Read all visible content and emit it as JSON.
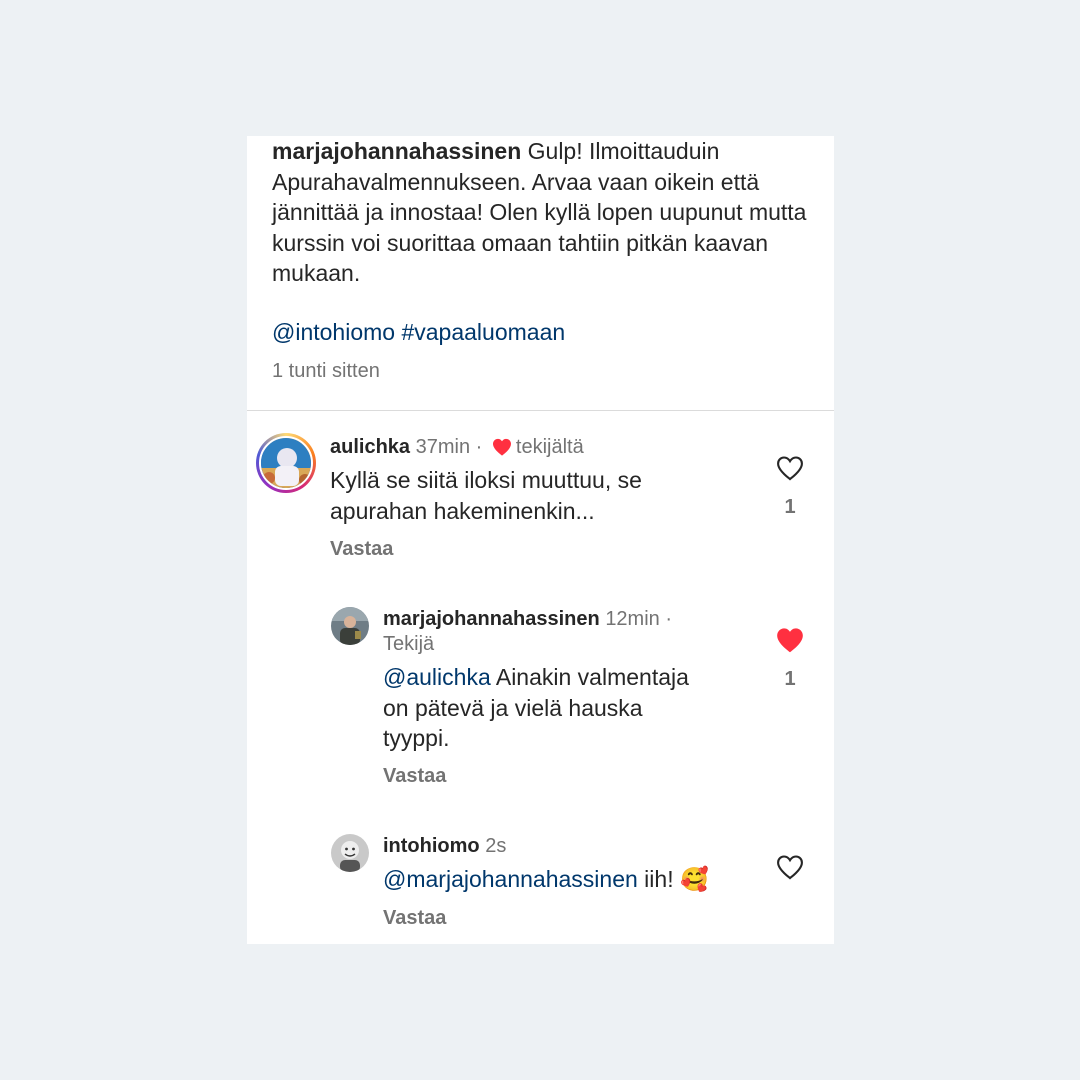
{
  "post": {
    "author": "marjajohannahassinen",
    "caption": "Gulp! Ilmoittauduin Apurahavalmennukseen. Arvaa vaan oikein että jännittää ja innostaa! Olen kyllä lopen uupunut mutta kurssin voi suorittaa omaan tahtiin pitkän kaavan mukaan.",
    "tag_mention": "@intohiomo",
    "tag_hashtag": "#vapaaluomaan",
    "time": "1 tunti sitten"
  },
  "comments": [
    {
      "username": "aulichka",
      "time": "37min",
      "separator": "·",
      "author_liked_label": "tekijältä",
      "text_line1": "Kyllä se siitä iloksi muuttuu, se",
      "text_line2": "apurahan hakeminenkin...",
      "reply_label": "Vastaa",
      "like_count": "1",
      "liked": false
    },
    {
      "username": "marjajohannahassinen",
      "time": "12min",
      "separator": "·",
      "badge": "Tekijä",
      "mention": "@aulichka",
      "text_line1_rest": " Ainakin valmentaja",
      "text_line2": "on pätevä ja vielä hauska",
      "text_line3": "tyyppi.",
      "reply_label": "Vastaa",
      "like_count": "1",
      "liked": true
    },
    {
      "username": "intohiomo",
      "time": "2s",
      "mention": "@marjajohannahassinen",
      "text_rest": " iih! ",
      "emoji": "🥰",
      "reply_label": "Vastaa",
      "liked": false
    }
  ],
  "colors": {
    "background": "#edf1f4",
    "card": "#ffffff",
    "text": "#262626",
    "secondary": "#737373",
    "link": "#00376b",
    "like_red": "#ff3040"
  },
  "icons": {
    "like": "heart-outline-icon",
    "liked": "heart-filled-icon"
  }
}
